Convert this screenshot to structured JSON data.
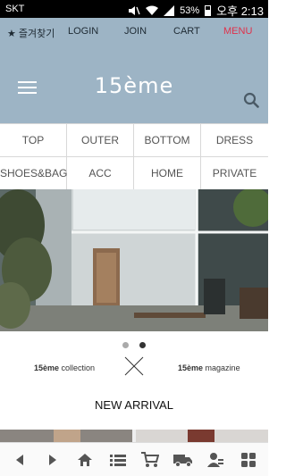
{
  "status_bar": {
    "carrier": "SKT",
    "battery": "53%",
    "time": "오후 2:13"
  },
  "top_nav": {
    "bookmark": "★ 즐겨찾기",
    "login": "LOGIN",
    "join": "JOIN",
    "cart": "CART",
    "menu": "MENU"
  },
  "header": {
    "logo": "15ème"
  },
  "categories": [
    "TOP",
    "OUTER",
    "BOTTOM",
    "DRESS",
    "SHOES&BAG",
    "ACC",
    "HOME",
    "PRIVATE"
  ],
  "promo": {
    "left_brand": "15ème",
    "left_text": "collection",
    "right_brand": "15ème",
    "right_text": "magazine"
  },
  "section": {
    "new_arrival": "NEW ARRIVAL"
  },
  "slider": {
    "current": 2,
    "total": 2
  },
  "icons": {
    "back": "back-arrow-icon",
    "forward": "forward-arrow-icon",
    "home": "home-icon",
    "list": "list-icon",
    "cart": "cart-icon",
    "delivery": "delivery-truck-icon",
    "user": "user-icon",
    "more": "grid-icon"
  },
  "colors": {
    "header_bg": "#9db4c5",
    "menu_accent": "#e0314b"
  }
}
